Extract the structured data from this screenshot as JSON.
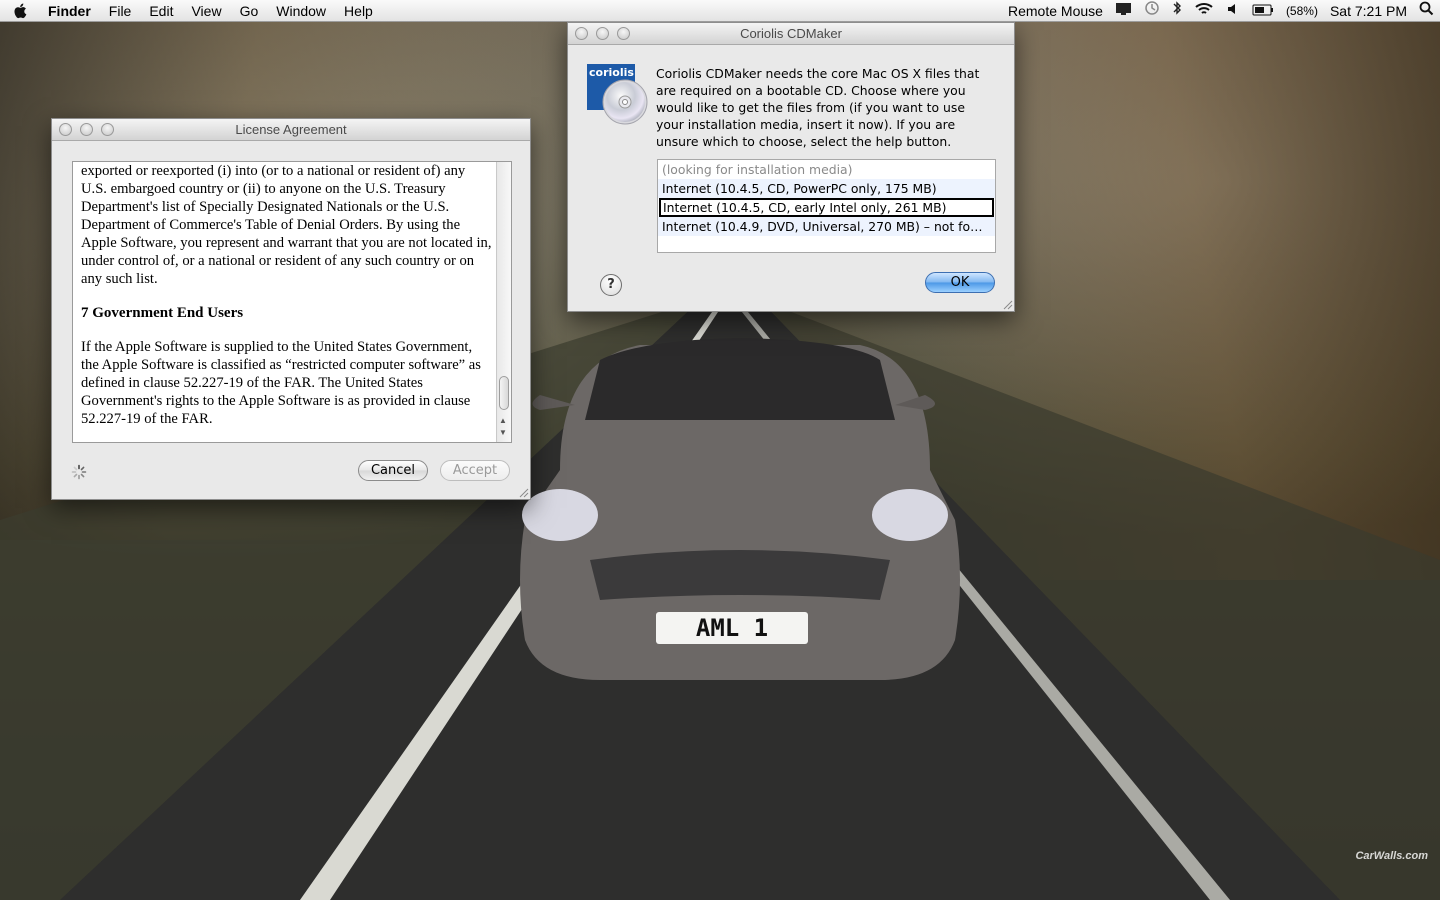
{
  "menubar": {
    "app_name": "Finder",
    "menus": [
      "File",
      "Edit",
      "View",
      "Go",
      "Window",
      "Help"
    ],
    "status": {
      "remote_mouse": "Remote Mouse",
      "battery_percent": "(58%)",
      "clock": "Sat 7:21 PM"
    }
  },
  "license_window": {
    "title": "License Agreement",
    "paragraph_1": "exported or reexported (i) into (or to a national or resident of) any U.S. embargoed country or (ii) to anyone on the U.S. Treasury Department's list of Specially Designated Nationals or the U.S. Department of Commerce's Table of Denial Orders. By using the Apple Software, you represent and warrant that you are not located in, under control of, or a national or resident of any such country or on any such list.",
    "heading": "7 Government End Users",
    "paragraph_2": "If the Apple Software is supplied to the United States Government, the Apple Software is classified as “restricted computer software” as defined in clause 52.227-19 of the FAR. The United States Government's rights to the Apple Software is as provided in clause 52.227-19 of the FAR.",
    "cancel_label": "Cancel",
    "accept_label": "Accept"
  },
  "cdmaker_window": {
    "title": "Coriolis CDMaker",
    "logo_text": "coriolis",
    "message": "Coriolis CDMaker needs the core Mac OS X files that are required on a bootable CD. Choose where you would like to get the files from (if you want to use your installation media, insert it now). If you are unsure which to choose, select the help button.",
    "sources": [
      "(looking for installation media)",
      "Internet (10.4.5, CD, PowerPC only, 175 MB)",
      "Internet (10.4.5, CD, early Intel only, 261 MB)",
      "Internet (10.4.9, DVD, Universal, 270 MB) – not fo…"
    ],
    "help_label": "?",
    "ok_label": "OK"
  },
  "wallpaper": {
    "plate": "AML 1",
    "watermark": "CarWalls.com"
  },
  "colors": {
    "accent": "#4b97e6",
    "list_alt_row": "#edf3fe"
  }
}
